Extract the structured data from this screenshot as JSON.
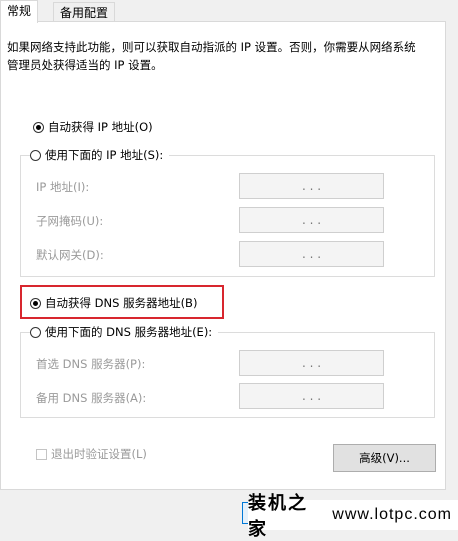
{
  "tabs": [
    {
      "label": "常规",
      "active": true
    },
    {
      "label": "备用配置",
      "active": false
    }
  ],
  "description": "如果网络支持此功能，则可以获取自动指派的 IP 设置。否则，你需要从网络系统管理员处获得适当的 IP 设置。",
  "ip": {
    "auto_label": "自动获得 IP 地址(O)",
    "auto_selected": true,
    "manual_label": "使用下面的 IP 地址(S):",
    "manual_selected": false,
    "fields": [
      {
        "label": "IP 地址(I):",
        "value": ".    .    ."
      },
      {
        "label": "子网掩码(U):",
        "value": ".    .    ."
      },
      {
        "label": "默认网关(D):",
        "value": ".    .    ."
      }
    ]
  },
  "dns": {
    "auto_label": "自动获得 DNS 服务器地址(B)",
    "auto_selected": true,
    "manual_label": "使用下面的 DNS 服务器地址(E):",
    "manual_selected": false,
    "fields": [
      {
        "label": "首选 DNS 服务器(P):",
        "value": ".    .    ."
      },
      {
        "label": "备用 DNS 服务器(A):",
        "value": ".    .    ."
      }
    ]
  },
  "validate_label": "退出时验证设置(L)",
  "validate_checked": false,
  "advanced_label": "高级(V)...",
  "highlight_color": "#d8262e",
  "watermark": {
    "cn": "装机之家",
    "url": "www.lotpc.com"
  }
}
